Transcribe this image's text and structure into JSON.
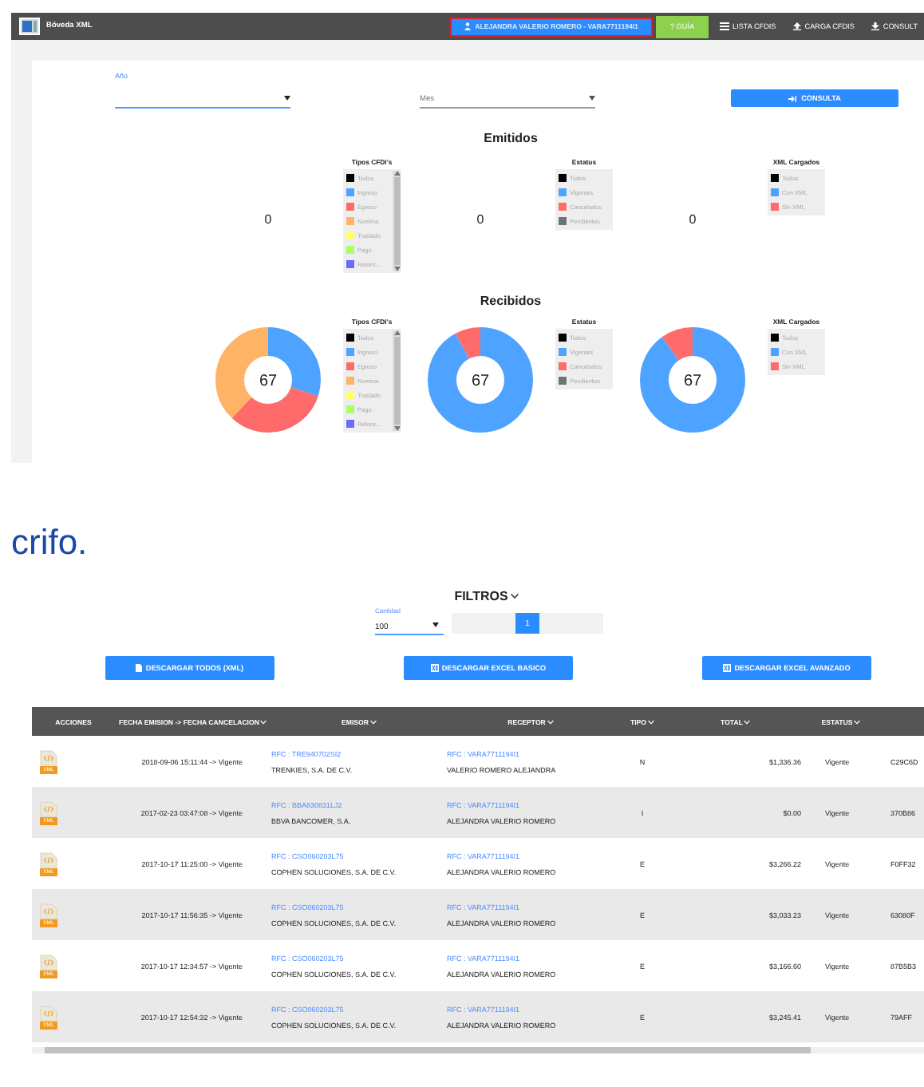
{
  "app": {
    "title": "Bóveda XML",
    "user": "ALEJANDRA VALERIO ROMERO - VARA7711194I1",
    "nav": [
      {
        "label": "? GUÍA",
        "kind": "guide"
      },
      {
        "label": "LISTA CFDIS",
        "kind": "list"
      },
      {
        "label": "CARGA CFDIS",
        "kind": "upload"
      },
      {
        "label": "CONSULT",
        "kind": "download"
      }
    ]
  },
  "form": {
    "year_label": "Año",
    "month_placeholder": "Mes",
    "submit": "CONSULTA"
  },
  "sections": [
    {
      "title": "Emitidos",
      "charts": [
        {
          "kind": "number",
          "value": "0",
          "legend_title": "Tipos CFDI's",
          "scrollable": true,
          "legend": [
            {
              "label": "Todos",
              "color": "#000000"
            },
            {
              "label": "Ingreso",
              "color": "#4da3ff"
            },
            {
              "label": "Egreso",
              "color": "#ff6b6b"
            },
            {
              "label": "Nomina",
              "color": "#ffb366"
            },
            {
              "label": "Traslado",
              "color": "#ffff66"
            },
            {
              "label": "Pago",
              "color": "#aaff66"
            },
            {
              "label": "Retenc...",
              "color": "#6b6bff"
            }
          ]
        },
        {
          "kind": "number",
          "value": "0",
          "legend_title": "Estatus",
          "scrollable": false,
          "legend": [
            {
              "label": "Todos",
              "color": "#000000"
            },
            {
              "label": "Vigentes",
              "color": "#4da3ff"
            },
            {
              "label": "Cancelados",
              "color": "#ff6b6b"
            },
            {
              "label": "Pendientes",
              "color": "#6e7377"
            }
          ]
        },
        {
          "kind": "number",
          "value": "0",
          "legend_title": "XML Cargados",
          "scrollable": false,
          "legend": [
            {
              "label": "Todos",
              "color": "#000000"
            },
            {
              "label": "Con XML",
              "color": "#4da3ff"
            },
            {
              "label": "Sin XML",
              "color": "#ff6b6b"
            }
          ]
        }
      ]
    },
    {
      "title": "Recibidos",
      "charts": [
        {
          "kind": "donut",
          "value": "67",
          "legend_title": "Tipos CFDI's",
          "scrollable": true,
          "legend": [
            {
              "label": "Todos",
              "color": "#000000"
            },
            {
              "label": "Ingreso",
              "color": "#4da3ff"
            },
            {
              "label": "Egreso",
              "color": "#ff6b6b"
            },
            {
              "label": "Nomina",
              "color": "#ffb366"
            },
            {
              "label": "Traslado",
              "color": "#ffff66"
            },
            {
              "label": "Pago",
              "color": "#aaff66"
            },
            {
              "label": "Retenc...",
              "color": "#6b6bff"
            }
          ]
        },
        {
          "kind": "donut",
          "value": "67",
          "legend_title": "Estatus",
          "scrollable": false,
          "legend": [
            {
              "label": "Todos",
              "color": "#000000"
            },
            {
              "label": "Vigentes",
              "color": "#4da3ff"
            },
            {
              "label": "Cancelados",
              "color": "#ff6b6b"
            },
            {
              "label": "Pendientes",
              "color": "#6e7377"
            }
          ]
        },
        {
          "kind": "donut",
          "value": "67",
          "legend_title": "XML Cargados",
          "scrollable": false,
          "legend": [
            {
              "label": "Todos",
              "color": "#000000"
            },
            {
              "label": "Con XML",
              "color": "#4da3ff"
            },
            {
              "label": "Sin XML",
              "color": "#ff6b6b"
            }
          ]
        }
      ]
    }
  ],
  "brand_fragment": "crifo.",
  "filters": {
    "title": "FILTROS",
    "quantity_label": "Cantidad",
    "quantity": "100",
    "pages": [
      {
        "label": "1",
        "selected": true
      }
    ]
  },
  "downloads": [
    {
      "label": "DESCARGAR TODOS (XML)",
      "kind": "file"
    },
    {
      "label": "DESCARGAR EXCEL BASICO",
      "kind": "excel"
    },
    {
      "label": "DESCARGAR EXCEL AVANZADO",
      "kind": "excel"
    }
  ],
  "table": {
    "columns": [
      {
        "label": "ACCIONES",
        "sortable": false
      },
      {
        "label": "FECHA EMISION -> FECHA CANCELACION",
        "sortable": true
      },
      {
        "label": "EMISOR",
        "sortable": true
      },
      {
        "label": "RECEPTOR",
        "sortable": true
      },
      {
        "label": "TIPO",
        "sortable": true
      },
      {
        "label": "TOTAL",
        "sortable": true
      },
      {
        "label": "ESTATUS",
        "sortable": true
      }
    ],
    "rows": [
      {
        "file_label": "XML",
        "date": "2018-09-06 15:11:44 -> Vigente",
        "emisor_rfc": "RFC : TRE940702SI2",
        "emisor": "TRENKIES, S.A. DE C.V.",
        "receptor_rfc": "RFC : VARA7711194I1",
        "receptor": "VALERIO ROMERO ALEJANDRA",
        "tipo": "N",
        "total": "$1,336.36",
        "estatus": "Vigente",
        "column_8": "C29C6D"
      },
      {
        "file_label": "XML",
        "date": "2017-02-23 03:47:08 -> Vigente",
        "emisor_rfc": "RFC : BBA830831LJ2",
        "emisor": "BBVA BANCOMER, S.A.",
        "receptor_rfc": "RFC : VARA7711194I1",
        "receptor": "ALEJANDRA VALERIO ROMERO",
        "tipo": "I",
        "total": "$0.00",
        "estatus": "Vigente",
        "column_8": "370B86"
      },
      {
        "file_label": "XML",
        "date": "2017-10-17 11:25:00 -> Vigente",
        "emisor_rfc": "RFC : CSO060203L75",
        "emisor": "COPHEN SOLUCIONES, S.A. DE C.V.",
        "receptor_rfc": "RFC : VARA7711194I1",
        "receptor": "ALEJANDRA VALERIO ROMERO",
        "tipo": "E",
        "total": "$3,266.22",
        "estatus": "Vigente",
        "column_8": "F0FF32"
      },
      {
        "file_label": "XML",
        "date": "2017-10-17 11:56:35 -> Vigente",
        "emisor_rfc": "RFC : CSO060203L75",
        "emisor": "COPHEN SOLUCIONES, S.A. DE C.V.",
        "receptor_rfc": "RFC : VARA7711194I1",
        "receptor": "ALEJANDRA VALERIO ROMERO",
        "tipo": "E",
        "total": "$3,033.23",
        "estatus": "Vigente",
        "column_8": "63080F"
      },
      {
        "file_label": "XML",
        "date": "2017-10-17 12:34:57 -> Vigente",
        "emisor_rfc": "RFC : CSO060203L75",
        "emisor": "COPHEN SOLUCIONES, S.A. DE C.V.",
        "receptor_rfc": "RFC : VARA7711194I1",
        "receptor": "ALEJANDRA VALERIO ROMERO",
        "tipo": "E",
        "total": "$3,166.60",
        "estatus": "Vigente",
        "column_8": "87B5B3"
      },
      {
        "file_label": "XML",
        "date": "2017-10-17 12:54:32 -> Vigente",
        "emisor_rfc": "RFC : CSO060203L75",
        "emisor": "COPHEN SOLUCIONES, S.A. DE C.V.",
        "receptor_rfc": "RFC : VARA7711194I1",
        "receptor": "ALEJANDRA VALERIO ROMERO",
        "tipo": "E",
        "total": "$3,245.41",
        "estatus": "Vigente",
        "column_8": "79AFF"
      }
    ]
  }
}
